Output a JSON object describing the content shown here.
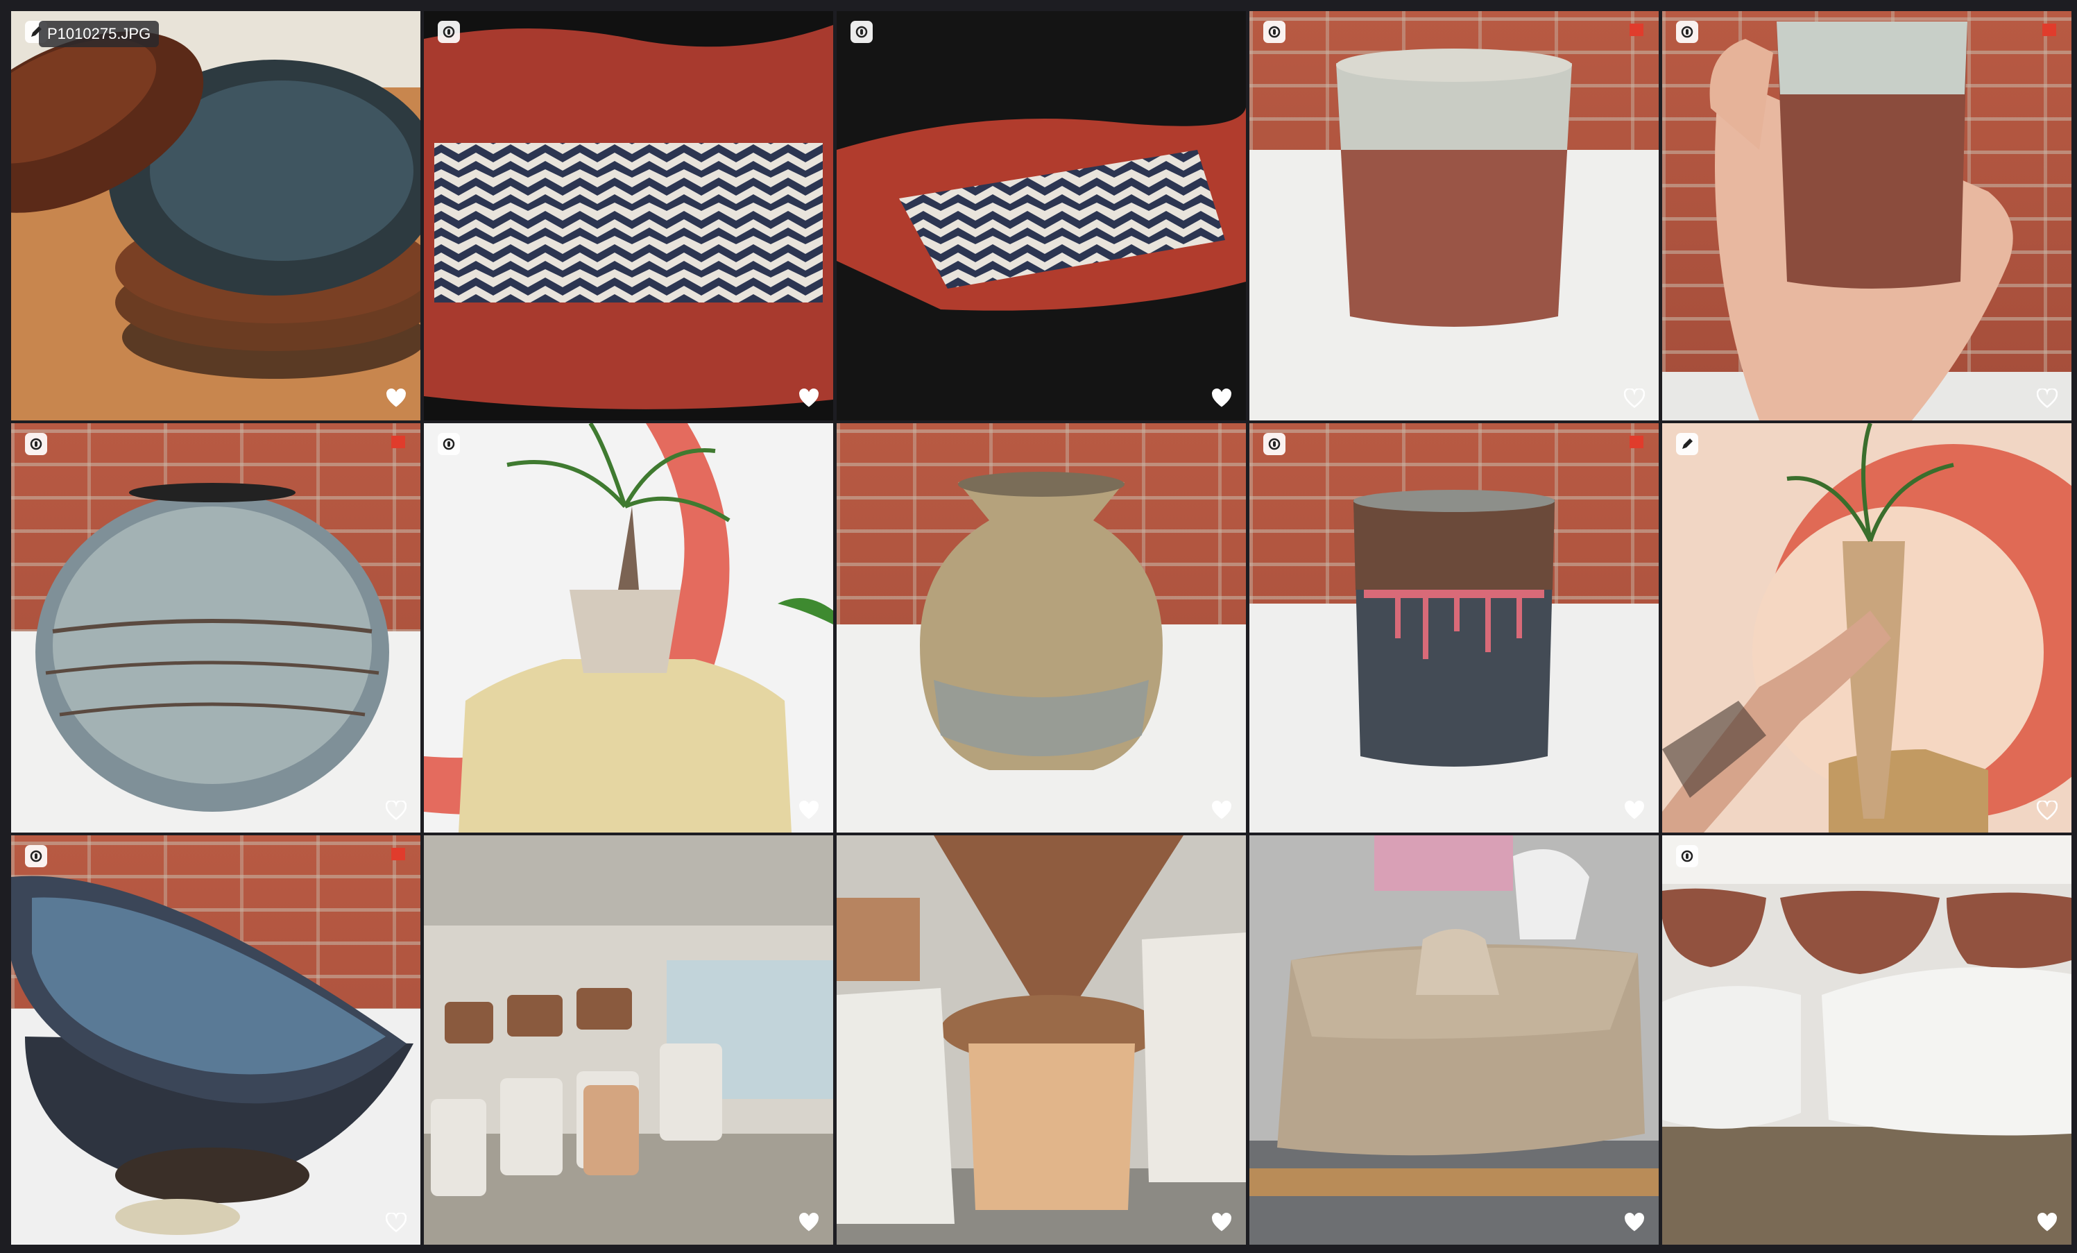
{
  "hover_filename": "P1010275.JPG",
  "tiles": [
    {
      "badge": "edit",
      "flag": false,
      "liked": true
    },
    {
      "badge": "link",
      "flag": false,
      "liked": true
    },
    {
      "badge": "link",
      "flag": false,
      "liked": true
    },
    {
      "badge": "link",
      "flag": true,
      "liked": false
    },
    {
      "badge": "link",
      "flag": true,
      "liked": false
    },
    {
      "badge": "link",
      "flag": true,
      "liked": false
    },
    {
      "badge": "link",
      "flag": false,
      "liked": true
    },
    {
      "badge": "none",
      "flag": false,
      "liked": true
    },
    {
      "badge": "link",
      "flag": true,
      "liked": true
    },
    {
      "badge": "edit",
      "flag": false,
      "liked": false
    },
    {
      "badge": "link",
      "flag": true,
      "liked": false
    },
    {
      "badge": "none",
      "flag": false,
      "liked": true
    },
    {
      "badge": "none",
      "flag": false,
      "liked": true
    },
    {
      "badge": "none",
      "flag": false,
      "liked": true
    },
    {
      "badge": "link",
      "flag": false,
      "liked": true
    }
  ],
  "colors": {
    "background": "#1d1d22",
    "flag": "#e03c2c",
    "heart": "#ffffff"
  }
}
